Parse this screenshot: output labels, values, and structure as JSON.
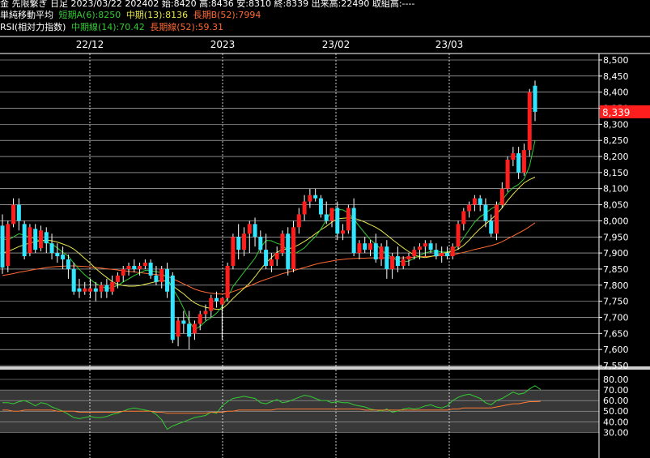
{
  "header": {
    "line1": "金 先限繋ぎ 日足 2023/03/22 202402 始:8420 高:8436 安:8310 終:8339 出来高:22490 取組高:----",
    "ma_title": "単純移動平均",
    "ma_short": "短期A(6):8250",
    "ma_mid": "中期(13):8136",
    "ma_long": "長期B(52):7994",
    "rsi_title": "RSI(相対力指数)",
    "rsi_mid": "中期線(14):70.42",
    "rsi_long": "長期線(52):59.31"
  },
  "colors": {
    "up": "#ff1e1e",
    "down": "#33e6ff",
    "ma_short": "#33cc33",
    "ma_mid": "#e6e64d",
    "ma_long": "#ff6a33",
    "rsi_mid": "#33cc33",
    "rsi_long": "#ff7a33",
    "grid": "#ffffff",
    "last_price_bg": "#ff1e1e"
  },
  "chart_data": [
    {
      "type": "candlestick",
      "x_tick_labels": [
        "22/12",
        "2023",
        "23/02",
        "23/03"
      ],
      "y_tick_labels": [
        "8,500",
        "8,450",
        "8,400",
        "8,350",
        "8,300",
        "8,250",
        "8,200",
        "8,150",
        "8,100",
        "8,050",
        "8,000",
        "7,950",
        "7,900",
        "7,850",
        "7,800",
        "7,750",
        "7,700",
        "7,650",
        "7,600",
        "7,550"
      ],
      "ylim": [
        7550,
        8500
      ],
      "last_price_label": "8,339",
      "last_price": 8339,
      "candles": [
        {
          "o": 7985,
          "h": 8020,
          "l": 7835,
          "c": 7855
        },
        {
          "o": 7860,
          "h": 8000,
          "l": 7840,
          "c": 7990
        },
        {
          "o": 7990,
          "h": 8070,
          "l": 7980,
          "c": 8050
        },
        {
          "o": 8050,
          "h": 8070,
          "l": 7970,
          "c": 8000
        },
        {
          "o": 7990,
          "h": 8000,
          "l": 7880,
          "c": 7890
        },
        {
          "o": 7900,
          "h": 7990,
          "l": 7890,
          "c": 7980
        },
        {
          "o": 7975,
          "h": 7990,
          "l": 7900,
          "c": 7910
        },
        {
          "o": 7915,
          "h": 7985,
          "l": 7905,
          "c": 7970
        },
        {
          "o": 7965,
          "h": 7980,
          "l": 7900,
          "c": 7930
        },
        {
          "o": 7930,
          "h": 7960,
          "l": 7880,
          "c": 7900
        },
        {
          "o": 7900,
          "h": 7930,
          "l": 7870,
          "c": 7890
        },
        {
          "o": 7895,
          "h": 7920,
          "l": 7850,
          "c": 7880
        },
        {
          "o": 7880,
          "h": 7895,
          "l": 7820,
          "c": 7850
        },
        {
          "o": 7850,
          "h": 7870,
          "l": 7770,
          "c": 7780
        },
        {
          "o": 7790,
          "h": 7820,
          "l": 7760,
          "c": 7780
        },
        {
          "o": 7780,
          "h": 7810,
          "l": 7770,
          "c": 7790
        },
        {
          "o": 7780,
          "h": 7820,
          "l": 7760,
          "c": 7790
        },
        {
          "o": 7790,
          "h": 7810,
          "l": 7750,
          "c": 7780
        },
        {
          "o": 7780,
          "h": 7810,
          "l": 7760,
          "c": 7800
        },
        {
          "o": 7800,
          "h": 7820,
          "l": 7760,
          "c": 7780
        },
        {
          "o": 7780,
          "h": 7830,
          "l": 7770,
          "c": 7810
        },
        {
          "o": 7810,
          "h": 7840,
          "l": 7790,
          "c": 7830
        },
        {
          "o": 7830,
          "h": 7860,
          "l": 7810,
          "c": 7850
        },
        {
          "o": 7850,
          "h": 7870,
          "l": 7830,
          "c": 7860
        },
        {
          "o": 7860,
          "h": 7880,
          "l": 7840,
          "c": 7850
        },
        {
          "o": 7850,
          "h": 7870,
          "l": 7830,
          "c": 7860
        },
        {
          "o": 7860,
          "h": 7880,
          "l": 7850,
          "c": 7870
        },
        {
          "o": 7870,
          "h": 7880,
          "l": 7820,
          "c": 7830
        },
        {
          "o": 7830,
          "h": 7860,
          "l": 7800,
          "c": 7810
        },
        {
          "o": 7810,
          "h": 7860,
          "l": 7790,
          "c": 7850
        },
        {
          "o": 7850,
          "h": 7870,
          "l": 7760,
          "c": 7780
        },
        {
          "o": 7830,
          "h": 7840,
          "l": 7620,
          "c": 7630
        },
        {
          "o": 7640,
          "h": 7700,
          "l": 7610,
          "c": 7690
        },
        {
          "o": 7690,
          "h": 7720,
          "l": 7650,
          "c": 7680
        },
        {
          "o": 7680,
          "h": 7720,
          "l": 7600,
          "c": 7640
        },
        {
          "o": 7650,
          "h": 7690,
          "l": 7630,
          "c": 7680
        },
        {
          "o": 7680,
          "h": 7720,
          "l": 7660,
          "c": 7710
        },
        {
          "o": 7710,
          "h": 7740,
          "l": 7690,
          "c": 7720
        },
        {
          "o": 7720,
          "h": 7770,
          "l": 7700,
          "c": 7760
        },
        {
          "o": 7760,
          "h": 7780,
          "l": 7730,
          "c": 7750
        },
        {
          "o": 7740,
          "h": 7760,
          "l": 7630,
          "c": 7760
        },
        {
          "o": 7760,
          "h": 7870,
          "l": 7750,
          "c": 7860
        },
        {
          "o": 7860,
          "h": 7960,
          "l": 7850,
          "c": 7950
        },
        {
          "o": 7950,
          "h": 7990,
          "l": 7880,
          "c": 7910
        },
        {
          "o": 7910,
          "h": 7980,
          "l": 7890,
          "c": 7960
        },
        {
          "o": 7960,
          "h": 8000,
          "l": 7900,
          "c": 7990
        },
        {
          "o": 7990,
          "h": 8010,
          "l": 7920,
          "c": 7950
        },
        {
          "o": 7950,
          "h": 7970,
          "l": 7900,
          "c": 7910
        },
        {
          "o": 7910,
          "h": 7960,
          "l": 7850,
          "c": 7860
        },
        {
          "o": 7860,
          "h": 7900,
          "l": 7840,
          "c": 7880
        },
        {
          "o": 7880,
          "h": 7920,
          "l": 7860,
          "c": 7900
        },
        {
          "o": 7900,
          "h": 7970,
          "l": 7890,
          "c": 7960
        },
        {
          "o": 7960,
          "h": 7980,
          "l": 7830,
          "c": 7850
        },
        {
          "o": 7850,
          "h": 8000,
          "l": 7840,
          "c": 7980
        },
        {
          "o": 7980,
          "h": 8040,
          "l": 7960,
          "c": 8020
        },
        {
          "o": 8020,
          "h": 8080,
          "l": 8000,
          "c": 8060
        },
        {
          "o": 8060,
          "h": 8100,
          "l": 8040,
          "c": 8080
        },
        {
          "o": 8080,
          "h": 8100,
          "l": 8060,
          "c": 8070
        },
        {
          "o": 8070,
          "h": 8080,
          "l": 8010,
          "c": 8020
        },
        {
          "o": 8020,
          "h": 8060,
          "l": 7990,
          "c": 8000
        },
        {
          "o": 8000,
          "h": 8040,
          "l": 7980,
          "c": 8040
        },
        {
          "o": 8040,
          "h": 8060,
          "l": 7940,
          "c": 7960
        },
        {
          "o": 7960,
          "h": 7990,
          "l": 7940,
          "c": 7970
        },
        {
          "o": 7970,
          "h": 8050,
          "l": 7960,
          "c": 8040
        },
        {
          "o": 8040,
          "h": 8070,
          "l": 7890,
          "c": 7900
        },
        {
          "o": 7900,
          "h": 7940,
          "l": 7880,
          "c": 7930
        },
        {
          "o": 7930,
          "h": 7950,
          "l": 7900,
          "c": 7910
        },
        {
          "o": 7910,
          "h": 7940,
          "l": 7890,
          "c": 7930
        },
        {
          "o": 7930,
          "h": 7960,
          "l": 7870,
          "c": 7880
        },
        {
          "o": 7880,
          "h": 7930,
          "l": 7860,
          "c": 7920
        },
        {
          "o": 7920,
          "h": 7940,
          "l": 7820,
          "c": 7850
        },
        {
          "o": 7850,
          "h": 7900,
          "l": 7820,
          "c": 7890
        },
        {
          "o": 7890,
          "h": 7920,
          "l": 7840,
          "c": 7860
        },
        {
          "o": 7860,
          "h": 7890,
          "l": 7850,
          "c": 7880
        },
        {
          "o": 7880,
          "h": 7900,
          "l": 7860,
          "c": 7890
        },
        {
          "o": 7890,
          "h": 7920,
          "l": 7880,
          "c": 7910
        },
        {
          "o": 7910,
          "h": 7930,
          "l": 7880,
          "c": 7920
        },
        {
          "o": 7920,
          "h": 7940,
          "l": 7890,
          "c": 7930
        },
        {
          "o": 7930,
          "h": 7940,
          "l": 7900,
          "c": 7910
        },
        {
          "o": 7910,
          "h": 7930,
          "l": 7880,
          "c": 7890
        },
        {
          "o": 7890,
          "h": 7920,
          "l": 7870,
          "c": 7900
        },
        {
          "o": 7900,
          "h": 7920,
          "l": 7880,
          "c": 7890
        },
        {
          "o": 7890,
          "h": 7930,
          "l": 7880,
          "c": 7920
        },
        {
          "o": 7920,
          "h": 8000,
          "l": 7910,
          "c": 7990
        },
        {
          "o": 7990,
          "h": 8040,
          "l": 7970,
          "c": 8030
        },
        {
          "o": 8030,
          "h": 8060,
          "l": 8010,
          "c": 8050
        },
        {
          "o": 8050,
          "h": 8080,
          "l": 8030,
          "c": 8070
        },
        {
          "o": 8070,
          "h": 8080,
          "l": 8030,
          "c": 8050
        },
        {
          "o": 8050,
          "h": 8070,
          "l": 7980,
          "c": 8000
        },
        {
          "o": 8000,
          "h": 8020,
          "l": 7950,
          "c": 7960
        },
        {
          "o": 7960,
          "h": 8060,
          "l": 7940,
          "c": 8050
        },
        {
          "o": 8050,
          "h": 8120,
          "l": 8040,
          "c": 8100
        },
        {
          "o": 8100,
          "h": 8200,
          "l": 8090,
          "c": 8190
        },
        {
          "o": 8190,
          "h": 8230,
          "l": 8170,
          "c": 8210
        },
        {
          "o": 8210,
          "h": 8230,
          "l": 8130,
          "c": 8150
        },
        {
          "o": 8150,
          "h": 8240,
          "l": 8140,
          "c": 8220
        },
        {
          "o": 8220,
          "h": 8410,
          "l": 8200,
          "c": 8400
        },
        {
          "o": 8420,
          "h": 8436,
          "l": 8310,
          "c": 8339
        }
      ],
      "ma_short": [
        7945,
        7940,
        7950,
        7960,
        7955,
        7950,
        7943,
        7937,
        7933,
        7928,
        7916,
        7902,
        7890,
        7868,
        7849,
        7832,
        7818,
        7805,
        7797,
        7790,
        7793,
        7799,
        7810,
        7820,
        7830,
        7838,
        7846,
        7845,
        7842,
        7838,
        7822,
        7790,
        7762,
        7728,
        7688,
        7662,
        7672,
        7688,
        7699,
        7713,
        7733,
        7761,
        7796,
        7818,
        7841,
        7862,
        7884,
        7916,
        7939,
        7938,
        7930,
        7925,
        7906,
        7896,
        7905,
        7916,
        7935,
        7951,
        7974,
        8003,
        8032,
        8035,
        8034,
        8025,
        8005,
        7983,
        7962,
        7941,
        7927,
        7910,
        7896,
        7886,
        7875,
        7872,
        7875,
        7884,
        7893,
        7900,
        7905,
        7906,
        7903,
        7903,
        7911,
        7924,
        7947,
        7972,
        7996,
        8013,
        8024,
        8037,
        8047,
        8064,
        8087,
        8103,
        8113,
        8130,
        8170,
        8250
      ],
      "ma_mid": [
        7900,
        7905,
        7912,
        7920,
        7926,
        7931,
        7935,
        7939,
        7940,
        7938,
        7934,
        7928,
        7922,
        7912,
        7898,
        7883,
        7868,
        7852,
        7837,
        7824,
        7811,
        7803,
        7799,
        7797,
        7797,
        7799,
        7803,
        7807,
        7811,
        7815,
        7811,
        7798,
        7785,
        7773,
        7758,
        7745,
        7737,
        7731,
        7728,
        7725,
        7726,
        7741,
        7759,
        7775,
        7790,
        7806,
        7826,
        7849,
        7869,
        7886,
        7902,
        7911,
        7912,
        7918,
        7926,
        7936,
        7947,
        7960,
        7972,
        7983,
        7996,
        8006,
        8008,
        8009,
        8008,
        8003,
        7996,
        7988,
        7980,
        7969,
        7956,
        7942,
        7929,
        7916,
        7904,
        7894,
        7888,
        7886,
        7889,
        7893,
        7898,
        7902,
        7905,
        7912,
        7924,
        7940,
        7959,
        7976,
        7990,
        8004,
        8021,
        8040,
        8063,
        8083,
        8101,
        8118,
        8128,
        8136
      ],
      "ma_long": [
        7830,
        7833,
        7836,
        7840,
        7843,
        7846,
        7849,
        7852,
        7855,
        7857,
        7858,
        7859,
        7860,
        7860,
        7859,
        7858,
        7857,
        7855,
        7853,
        7851,
        7849,
        7847,
        7845,
        7843,
        7841,
        7839,
        7837,
        7835,
        7833,
        7831,
        7828,
        7820,
        7812,
        7804,
        7796,
        7788,
        7782,
        7778,
        7775,
        7773,
        7772,
        7775,
        7780,
        7786,
        7792,
        7798,
        7805,
        7812,
        7818,
        7824,
        7830,
        7836,
        7840,
        7845,
        7850,
        7855,
        7860,
        7865,
        7869,
        7872,
        7875,
        7878,
        7880,
        7882,
        7883,
        7884,
        7884,
        7885,
        7885,
        7885,
        7885,
        7885,
        7885,
        7885,
        7886,
        7887,
        7888,
        7889,
        7890,
        7891,
        7892,
        7893,
        7895,
        7898,
        7902,
        7906,
        7911,
        7915,
        7919,
        7923,
        7928,
        7935,
        7944,
        7953,
        7962,
        7971,
        7982,
        7994
      ],
      "ma_colors": [
        "#33cc33",
        "#e6e64d",
        "#ff6a33"
      ]
    },
    {
      "type": "line",
      "title": "RSI(相対力指数)",
      "y_tick_labels": [
        "80.00",
        "70.00",
        "60.00",
        "50.00",
        "40.00",
        "30.00"
      ],
      "ylim": [
        20,
        90
      ],
      "highlight_band": [
        30,
        70
      ],
      "series": [
        {
          "name": "中期線(14)",
          "values": [
            58,
            58,
            57,
            59,
            60,
            58,
            55,
            58,
            57,
            54,
            52,
            50,
            47,
            44,
            43,
            44,
            45,
            44,
            44,
            45,
            47,
            48,
            50,
            52,
            53,
            52,
            51,
            50,
            47,
            42,
            33,
            36,
            38,
            40,
            42,
            44,
            45,
            46,
            49,
            48,
            55,
            59,
            62,
            63,
            64,
            63,
            62,
            58,
            57,
            59,
            61,
            58,
            59,
            61,
            63,
            65,
            64,
            62,
            60,
            60,
            58,
            59,
            58,
            58,
            56,
            55,
            54,
            52,
            51,
            50,
            52,
            49,
            50,
            52,
            53,
            52,
            53,
            55,
            56,
            54,
            53,
            55,
            60,
            63,
            65,
            66,
            64,
            62,
            58,
            56,
            60,
            62,
            65,
            68,
            66,
            67,
            71,
            74,
            70.42
          ]
        },
        {
          "name": "長期線(52)",
          "values": [
            51,
            51,
            50,
            50,
            51,
            51,
            51,
            51,
            51,
            51,
            50,
            50,
            50,
            50,
            49,
            49,
            49,
            49,
            49,
            49,
            49,
            49,
            50,
            50,
            50,
            50,
            50,
            50,
            49,
            49,
            48,
            48,
            48,
            48,
            48,
            48,
            48,
            48,
            49,
            49,
            49,
            50,
            50,
            51,
            51,
            51,
            51,
            51,
            51,
            51,
            52,
            52,
            52,
            52,
            52,
            52,
            52,
            52,
            52,
            52,
            52,
            52,
            52,
            52,
            52,
            52,
            51,
            51,
            51,
            51,
            51,
            51,
            51,
            51,
            51,
            51,
            51,
            51,
            51,
            51,
            51,
            51,
            52,
            52,
            53,
            53,
            53,
            53,
            53,
            53,
            54,
            55,
            56,
            57,
            57,
            58,
            59,
            59,
            59.31
          ]
        }
      ]
    }
  ]
}
